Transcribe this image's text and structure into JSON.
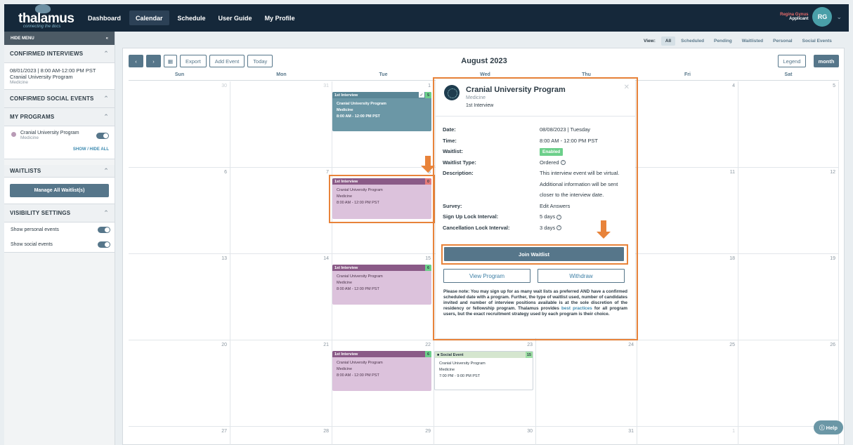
{
  "nav": {
    "logo_word": "thalamus",
    "logo_tag": "connecting the docs",
    "items": [
      "Dashboard",
      "Calendar",
      "Schedule",
      "User Guide",
      "My Profile"
    ],
    "user_name": "Regina Gynus",
    "user_role": "Applicant",
    "user_initials": "RG"
  },
  "sidebar": {
    "hide_menu": "HIDE MENU",
    "confirmed_interviews": "CONFIRMED INTERVIEWS",
    "interview_line": "08/01/2023 | 8:00 AM-12:00 PM PST",
    "interview_program": "Cranial University Program",
    "interview_specialty": "Medicine",
    "confirmed_social": "CONFIRMED SOCIAL EVENTS",
    "my_programs": "MY PROGRAMS",
    "program_name": "Cranial University Program",
    "program_specialty": "Medicine",
    "show_hide_all": "SHOW / HIDE ALL",
    "waitlists": "WAITLISTS",
    "manage_waitlists": "Manage All Waitlist(s)",
    "visibility": "VISIBILITY SETTINGS",
    "show_personal": "Show personal events",
    "show_social": "Show social events"
  },
  "viewbar": {
    "label": "View:",
    "options": [
      "All",
      "Scheduled",
      "Pending",
      "Waitlisted",
      "Personal",
      "Social Events"
    ]
  },
  "calendar": {
    "title": "August 2023",
    "export": "Export",
    "add_event": "Add Event",
    "today": "Today",
    "legend": "Legend",
    "month": "month",
    "days": [
      "Sun",
      "Mon",
      "Tue",
      "Wed",
      "Thu",
      "Fri",
      "Sat"
    ],
    "weeks": [
      [
        "30",
        "31",
        "1",
        "2",
        "3",
        "4",
        "5"
      ],
      [
        "6",
        "7",
        "8",
        "9",
        "10",
        "11",
        "12"
      ],
      [
        "13",
        "14",
        "15",
        "16",
        "17",
        "18",
        "19"
      ],
      [
        "20",
        "21",
        "22",
        "23",
        "24",
        "25",
        "26"
      ],
      [
        "27",
        "28",
        "29",
        "30",
        "31",
        "1",
        ""
      ]
    ],
    "event_label": "1st Interview",
    "social_label": "Social Event",
    "program": "Cranial University Program",
    "specialty": "Medicine",
    "time": "8:00 AM - 12:00 PM PST",
    "social_time": "7:00 PM - 9:00 PM PST",
    "counts": {
      "aug1": "5",
      "aug8": "0",
      "aug15": "6",
      "aug22": "6",
      "aug23": "15"
    }
  },
  "popup": {
    "title": "Cranial University Program",
    "specialty": "Medicine",
    "type": "1st Interview",
    "date_k": "Date:",
    "date_v": "08/08/2023 | Tuesday",
    "time_k": "Time:",
    "time_v": "8:00 AM - 12:00 PM PST",
    "waitlist_k": "Waitlist:",
    "waitlist_v": "Enabled",
    "wltype_k": "Waitlist Type:",
    "wltype_v": "Ordered",
    "desc_k": "Description:",
    "desc_v": "This interview event will be virtual.  Additional information will be sent closer to the interview date.",
    "survey_k": "Survey:",
    "survey_v": "Edit Answers",
    "signup_k": "Sign Up Lock Interval:",
    "signup_v": "5 days",
    "cancel_k": "Cancellation Lock Interval:",
    "cancel_v": "3 days",
    "join": "Join Waitlist",
    "view_program": "View Program",
    "withdraw": "Withdraw",
    "note_a": "Please note: You may sign up for as many wait lists as preferred AND have a confirmed scheduled date with a program. Further, the type of waitlist used, number of candidates invited and number of interview positions available is at the sole discretion of the residency or fellowship program. Thalamus provides ",
    "note_link": "best practices",
    "note_b": " for all program users, but the exact recruitment strategy used by each program is their choice."
  },
  "help": "Help",
  "colors": {
    "nav": "#15283a",
    "accent": "#56768a",
    "highlight": "#e8833a",
    "interview": "#8a5a87",
    "confirmed": "#6b97a6",
    "enabled": "#6ccf8a"
  }
}
